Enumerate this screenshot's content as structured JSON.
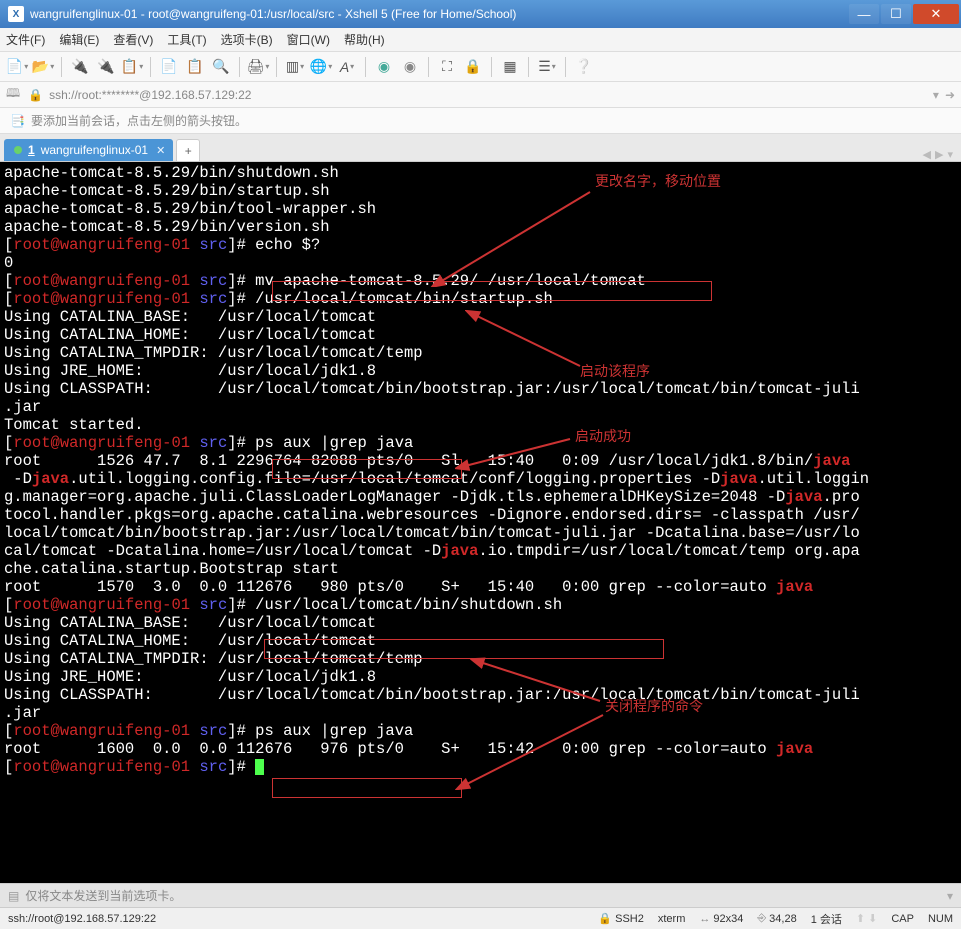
{
  "window": {
    "title": "wangruifenglinux-01 - root@wangruifeng-01:/usr/local/src - Xshell 5 (Free for Home/School)"
  },
  "menu": {
    "file": "文件(F)",
    "edit": "编辑(E)",
    "view": "查看(V)",
    "tools": "工具(T)",
    "tabs": "选项卡(B)",
    "window": "窗口(W)",
    "help": "帮助(H)"
  },
  "address": "ssh://root:********@192.168.57.129:22",
  "hint": "要添加当前会话，点击左侧的箭头按钮。",
  "tab": {
    "num": "1",
    "label": "wangruifenglinux-01"
  },
  "term": {
    "l1": "apache-tomcat-8.5.29/bin/shutdown.sh",
    "l2": "apache-tomcat-8.5.29/bin/startup.sh",
    "l3": "apache-tomcat-8.5.29/bin/tool-wrapper.sh",
    "l4": "apache-tomcat-8.5.29/bin/version.sh",
    "p_open": "[",
    "p_user": "root@wangruifeng-01",
    "p_dir": " src",
    "p_close": "]# ",
    "c5": "echo $?",
    "l6": "0",
    "c7": "mv apache-tomcat-8.5.29/ /usr/local/tomcat",
    "c8": "/usr/local/tomcat/bin/startup.sh",
    "l9": "Using CATALINA_BASE:   /usr/local/tomcat",
    "l10": "Using CATALINA_HOME:   /usr/local/tomcat",
    "l11": "Using CATALINA_TMPDIR: /usr/local/tomcat/temp",
    "l12": "Using JRE_HOME:        /usr/local/jdk1.8",
    "l13a": "Using CLASSPATH:       /usr/local/tomcat/bin/bootstrap.jar:/usr/local/tomcat/bin/tomcat-juli",
    "l13b": ".jar",
    "l14": "Tomcat started.",
    "c15": "ps aux |grep java",
    "l16a": "root      1526 47.7  8.1 2296764 82088 pts/0   Sl   15:40   0:09 /usr/local/jdk1.8/bin/",
    "l16b": "java",
    "l17a": " -D",
    "l17b": "java",
    "l17c": ".util.logging.config.file=/usr/local/tomcat/conf/logging.properties -D",
    "l17d": "java",
    "l17e": ".util.loggin",
    "l18a": "g.manager=org.apache.juli.ClassLoaderLogManager -Djdk.tls.ephemeralDHKeySize=2048 -D",
    "l18b": "java",
    "l18c": ".pro",
    "l19": "tocol.handler.pkgs=org.apache.catalina.webresources -Dignore.endorsed.dirs= -classpath /usr/",
    "l20": "local/tomcat/bin/bootstrap.jar:/usr/local/tomcat/bin/tomcat-juli.jar -Dcatalina.base=/usr/lo",
    "l21a": "cal/tomcat -Dcatalina.home=/usr/local/tomcat -D",
    "l21b": "java",
    "l21c": ".io.tmpdir=/usr/local/tomcat/temp org.apa",
    "l22": "che.catalina.startup.Bootstrap start",
    "l23a": "root      1570  3.0  0.0 112676   980 pts/0    S+   15:40   0:00 grep --color=auto ",
    "l23b": "java",
    "c24": "/usr/local/tomcat/bin/shutdown.sh",
    "l25": "Using CATALINA_BASE:   /usr/local/tomcat",
    "l26": "Using CATALINA_HOME:   /usr/local/tomcat",
    "l27": "Using CATALINA_TMPDIR: /usr/local/tomcat/temp",
    "l28": "Using JRE_HOME:        /usr/local/jdk1.8",
    "l29a": "Using CLASSPATH:       /usr/local/tomcat/bin/bootstrap.jar:/usr/local/tomcat/bin/tomcat-juli",
    "l29b": ".jar",
    "c30": "ps aux |grep java",
    "l31a": "root      1600  0.0  0.0 112676   976 pts/0    S+   15:42   0:00 grep --color=auto ",
    "l31b": "java"
  },
  "annotations": {
    "a1": "更改名字，移动位置",
    "a2": "启动该程序",
    "a3": "启动成功",
    "a4": "关闭程序的命令"
  },
  "sendbar": "仅将文本发送到当前选项卡。",
  "status": {
    "left": "ssh://root@192.168.57.129:22",
    "ssh": "SSH2",
    "term": "xterm",
    "size": "92x34",
    "pos": "34,28",
    "sess": "1 会话",
    "caps": "CAP",
    "num": "NUM"
  }
}
